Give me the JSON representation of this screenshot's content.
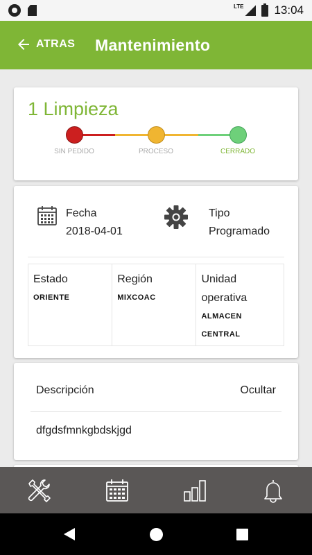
{
  "status_bar": {
    "time": "13:04",
    "network": "LTE"
  },
  "app_bar": {
    "back_label": "ATRAS",
    "title": "Mantenimiento"
  },
  "summary": {
    "title": "1 Limpieza",
    "steps": [
      "SIN PEDIDO",
      "PROCESO",
      "CERRADO"
    ],
    "step_colors": [
      "#cc1f1f",
      "#f0b531",
      "#6ed07a"
    ],
    "accent": "#7fb636"
  },
  "details": {
    "fecha_label": "Fecha",
    "fecha_value": "2018-04-01",
    "tipo_label": "Tipo",
    "tipo_value": "Programado",
    "estado_label": "Estado",
    "estado_value": "ORIENTE",
    "region_label": "Región",
    "region_value": "MIXCOAC",
    "unidad_label_1": "Unidad",
    "unidad_label_2": "operativa",
    "unidad_value_1": "ALMACEN",
    "unidad_value_2": "CENTRAL"
  },
  "description": {
    "label": "Descripción",
    "toggle_label": "Ocultar",
    "text": "dfgdsfmnkgbdskjgd"
  },
  "bottom_nav": {
    "items": [
      "tools-icon",
      "calendar-icon",
      "chart-bars-icon",
      "bell-icon"
    ],
    "background": "#5a5756"
  }
}
